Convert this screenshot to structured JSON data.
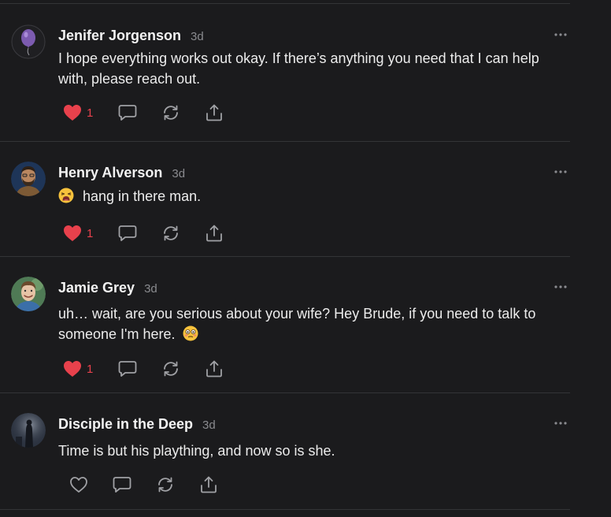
{
  "colors": {
    "background": "#1b1b1d",
    "divider": "#333437",
    "text": "#ececec",
    "muted": "#8a8b8f",
    "liked": "#e8414c"
  },
  "posts": [
    {
      "avatar_icon": "purple-balloon-avatar",
      "author": "Jenifer Jorgenson",
      "time": "3d",
      "text": "I hope everything works out okay. If there’s anything you need that I can help with, please reach out.",
      "liked": true,
      "like_count": "1"
    },
    {
      "avatar_icon": "bearded-man-avatar",
      "author": "Henry Alverson",
      "time": "3d",
      "emoji_icon": "tired-face-emoji",
      "text": "hang in there man.",
      "liked": true,
      "like_count": "1"
    },
    {
      "avatar_icon": "smiling-man-avatar",
      "author": "Jamie Grey",
      "time": "3d",
      "text": "uh… wait, are you serious about your wife? Hey Brude, if you need to talk to someone I'm here.",
      "trailing_emoji_icon": "flushed-face-emoji",
      "liked": true,
      "like_count": "1"
    },
    {
      "avatar_icon": "dark-figure-avatar",
      "author": "Disciple in the Deep",
      "time": "3d",
      "text": "Time is but his plaything, and now so is she.",
      "liked": false,
      "like_count": ""
    }
  ]
}
